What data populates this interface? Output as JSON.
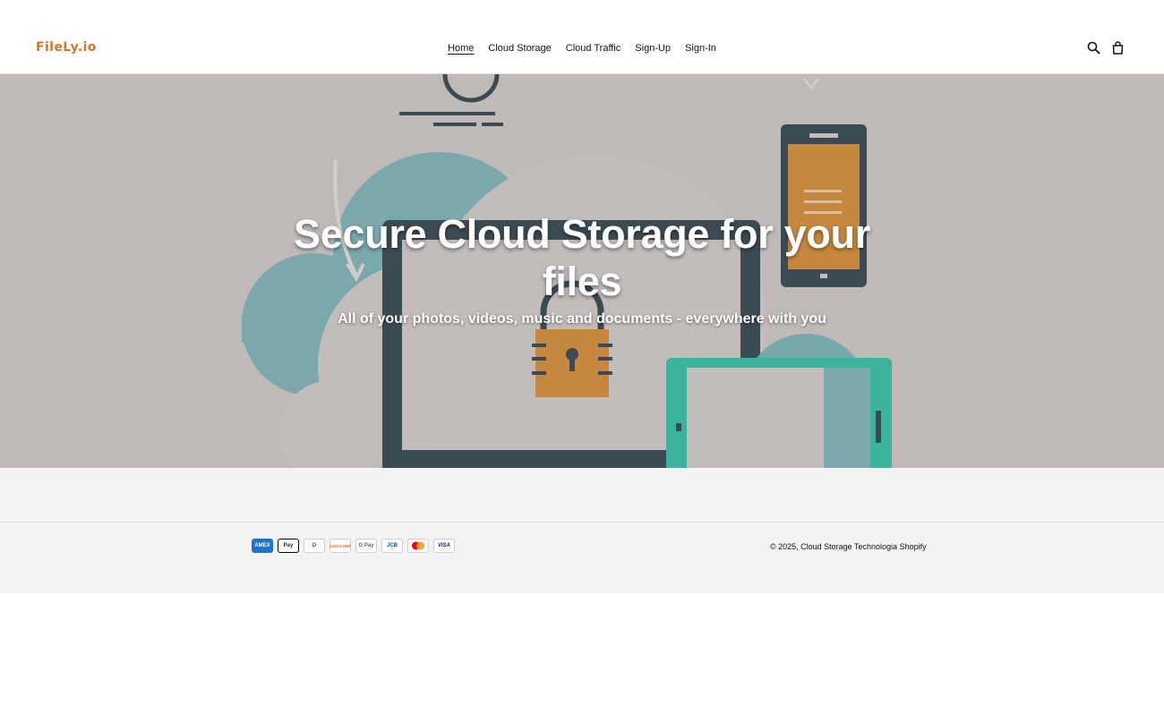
{
  "brand": {
    "logo_text": "FileLy.io",
    "accent": "#d8742a"
  },
  "nav": {
    "items": [
      {
        "label": "Home",
        "active": true
      },
      {
        "label": "Cloud Storage",
        "active": false
      },
      {
        "label": "Cloud Traffic",
        "active": false
      },
      {
        "label": "Sign-Up",
        "active": false
      },
      {
        "label": "Sign-In",
        "active": false
      }
    ]
  },
  "header_icons": [
    "search-icon",
    "cart-icon"
  ],
  "hero": {
    "title": "Secure Cloud Storage for your files",
    "subtitle": "All of your photos, videos, music and documents - everywhere with you",
    "background_color": "#bfb9b8"
  },
  "footer": {
    "payment_methods": [
      "AMEX",
      "Pay",
      "D",
      "DISCOVER",
      "G Pay",
      "JCB",
      "MC",
      "VISA"
    ],
    "copyright": "© 2025, Cloud Storage Technologia Shopify"
  }
}
